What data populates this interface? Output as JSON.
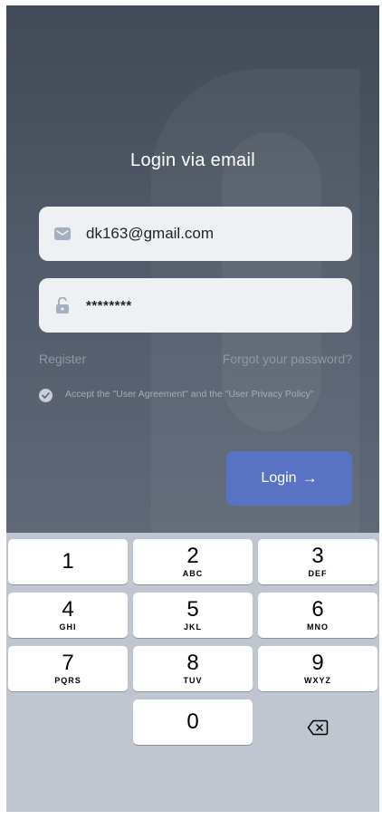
{
  "login": {
    "title": "Login via email",
    "email_value": "dk163@gmail.com",
    "password_value": "********",
    "register_label": "Register",
    "forgot_label": "Forgot your password?",
    "agreement_text": "Accept the \"User Agreement\" and the \"User Privacy Policy\"",
    "agreement_checked": true,
    "login_button_label": "Login",
    "login_button_arrow": "→",
    "button_color": "#5a72c2"
  },
  "keypad": {
    "keys": [
      {
        "digit": "1",
        "letters": ""
      },
      {
        "digit": "2",
        "letters": "ABC"
      },
      {
        "digit": "3",
        "letters": "DEF"
      },
      {
        "digit": "4",
        "letters": "GHI"
      },
      {
        "digit": "5",
        "letters": "JKL"
      },
      {
        "digit": "6",
        "letters": "MNO"
      },
      {
        "digit": "7",
        "letters": "PQRS"
      },
      {
        "digit": "8",
        "letters": "TUV"
      },
      {
        "digit": "9",
        "letters": "WXYZ"
      },
      {
        "digit": "0",
        "letters": ""
      }
    ],
    "delete_icon": "backspace-icon"
  }
}
